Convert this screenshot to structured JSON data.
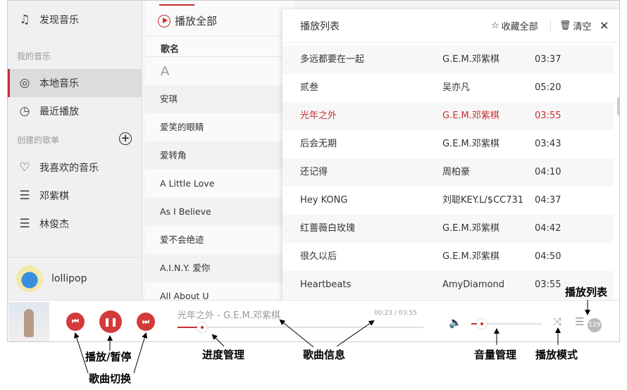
{
  "sidebar": {
    "discover": "发现音乐",
    "my_music": "我的音乐",
    "local": "本地音乐",
    "recent": "最近播放",
    "created": "创建的歌单",
    "playlists": [
      "我喜欢的音乐",
      "邓紫棋",
      "林俊杰"
    ],
    "user": "lollipop"
  },
  "middle": {
    "play_all": "播放全部",
    "col_name": "歌名",
    "letter": "A",
    "songs": [
      "安琪",
      "爱笑的眼睛",
      "爱转角",
      "A Little Love",
      "As I Believe",
      "爱不会绝迹",
      "A.I.N.Y. 爱你",
      "All About U"
    ]
  },
  "panel": {
    "title": "播放列表",
    "collect_all": "收藏全部",
    "clear": "清空",
    "rows": [
      {
        "title": "多远都要在一起",
        "artist": "G.E.M.邓紫棋",
        "duration": "03:37"
      },
      {
        "title": "贰叁",
        "artist": "吴亦凡",
        "duration": "05:20"
      },
      {
        "title": "光年之外",
        "artist": "G.E.M.邓紫棋",
        "duration": "03:55",
        "current": true
      },
      {
        "title": "后会无期",
        "artist": "G.E.M.邓紫棋",
        "duration": "03:43"
      },
      {
        "title": "还记得",
        "artist": "周柏豪",
        "duration": "04:10"
      },
      {
        "title": "Hey KONG",
        "artist": "刘聪KEY.L/$CC731",
        "duration": "04:37"
      },
      {
        "title": "红蔷薇白玫瑰",
        "artist": "G.E.M.邓紫棋",
        "duration": "04:42"
      },
      {
        "title": "很久以后",
        "artist": "G.E.M.邓紫棋",
        "duration": "04:50"
      },
      {
        "title": "Heartbeats",
        "artist": "AmyDiamond",
        "duration": "03:55"
      }
    ]
  },
  "player": {
    "song_info": "光年之外 - G.E.M.邓紫棋",
    "elapsed": "00:23",
    "total": "03:55",
    "time_sep": "/",
    "progress_pct": 10,
    "volume_pct": 15,
    "playlist_count": "129"
  },
  "annotations": {
    "play_pause": "播放/暂停",
    "switch": "歌曲切换",
    "progress": "进度管理",
    "info": "歌曲信息",
    "volume": "音量管理",
    "mode": "播放模式",
    "playlist": "播放列表"
  },
  "colors": {
    "accent": "#c62f2f"
  }
}
